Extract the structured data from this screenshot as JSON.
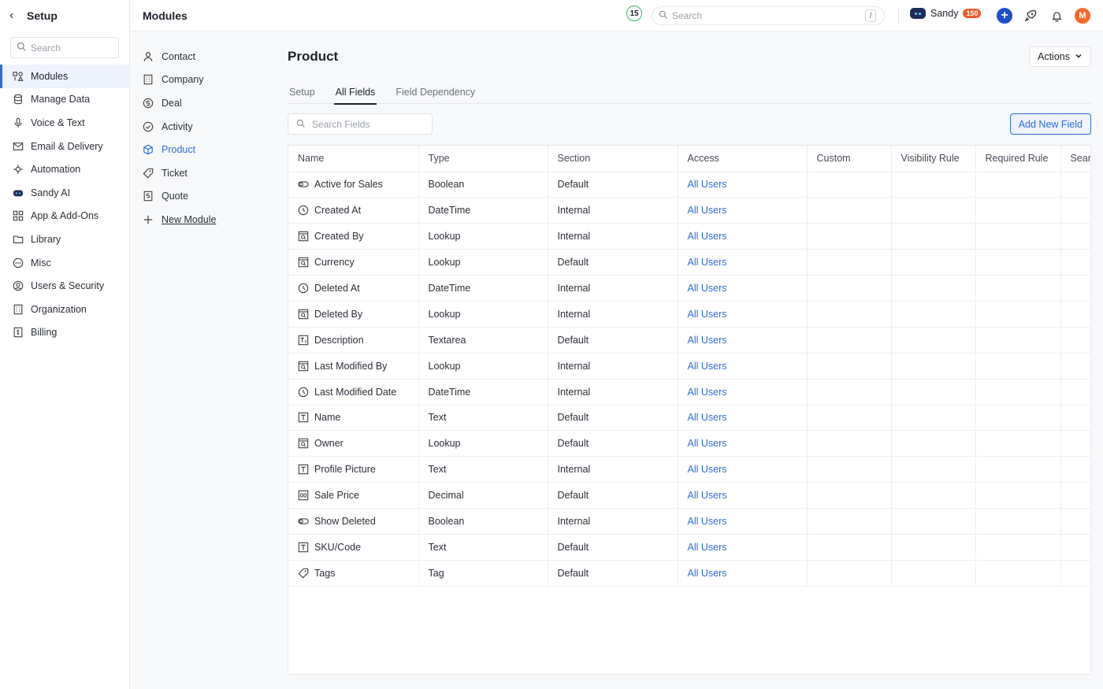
{
  "sidebar": {
    "title": "Setup",
    "search_placeholder": "Search",
    "items": [
      {
        "label": "Modules",
        "icon": "modules-icon",
        "active": true
      },
      {
        "label": "Manage Data",
        "icon": "database-icon"
      },
      {
        "label": "Voice & Text",
        "icon": "microphone-icon"
      },
      {
        "label": "Email & Delivery",
        "icon": "mail-icon"
      },
      {
        "label": "Automation",
        "icon": "automation-icon"
      },
      {
        "label": "Sandy AI",
        "icon": "bot-icon"
      },
      {
        "label": "App & Add-Ons",
        "icon": "apps-grid-icon"
      },
      {
        "label": "Library",
        "icon": "folder-icon"
      },
      {
        "label": "Misc",
        "icon": "more-circle-icon"
      },
      {
        "label": "Users & Security",
        "icon": "user-circle-icon"
      },
      {
        "label": "Organization",
        "icon": "building-icon"
      },
      {
        "label": "Billing",
        "icon": "billing-icon"
      }
    ]
  },
  "topbar": {
    "title": "Modules",
    "count": "15",
    "search_placeholder": "Search",
    "search_shortcut": "/",
    "user_name": "Sandy",
    "credits": "150",
    "avatar_letter": "M"
  },
  "modules": [
    {
      "label": "Contact",
      "icon": "person-icon"
    },
    {
      "label": "Company",
      "icon": "building-icon"
    },
    {
      "label": "Deal",
      "icon": "dollar-icon"
    },
    {
      "label": "Activity",
      "icon": "check-circle-icon"
    },
    {
      "label": "Product",
      "icon": "cube-icon",
      "active": true
    },
    {
      "label": "Ticket",
      "icon": "tag-icon"
    },
    {
      "label": "Quote",
      "icon": "quote-icon"
    },
    {
      "label": "New Module",
      "icon": "plus-icon",
      "is_new": true
    }
  ],
  "main": {
    "title": "Product",
    "actions_label": "Actions",
    "tabs": [
      {
        "label": "Setup"
      },
      {
        "label": "All Fields",
        "active": true
      },
      {
        "label": "Field Dependency"
      }
    ],
    "search_placeholder": "Search Fields",
    "add_field_label": "Add New Field",
    "columns": [
      "Name",
      "Type",
      "Section",
      "Access",
      "Custom",
      "Visibility Rule",
      "Required Rule",
      "Searc"
    ],
    "rows": [
      {
        "name": "Active for Sales",
        "type": "Boolean",
        "section": "Default",
        "access": "All Users",
        "icon": "toggle-icon"
      },
      {
        "name": "Created At",
        "type": "DateTime",
        "section": "Internal",
        "access": "All Users",
        "icon": "clock-icon"
      },
      {
        "name": "Created By",
        "type": "Lookup",
        "section": "Internal",
        "access": "All Users",
        "icon": "lookup-icon"
      },
      {
        "name": "Currency",
        "type": "Lookup",
        "section": "Default",
        "access": "All Users",
        "icon": "lookup-icon"
      },
      {
        "name": "Deleted At",
        "type": "DateTime",
        "section": "Internal",
        "access": "All Users",
        "icon": "clock-icon"
      },
      {
        "name": "Deleted By",
        "type": "Lookup",
        "section": "Internal",
        "access": "All Users",
        "icon": "lookup-icon"
      },
      {
        "name": "Description",
        "type": "Textarea",
        "section": "Default",
        "access": "All Users",
        "icon": "textarea-icon"
      },
      {
        "name": "Last Modified By",
        "type": "Lookup",
        "section": "Internal",
        "access": "All Users",
        "icon": "lookup-icon"
      },
      {
        "name": "Last Modified Date",
        "type": "DateTime",
        "section": "Internal",
        "access": "All Users",
        "icon": "clock-icon"
      },
      {
        "name": "Name",
        "type": "Text",
        "section": "Default",
        "access": "All Users",
        "icon": "text-icon"
      },
      {
        "name": "Owner",
        "type": "Lookup",
        "section": "Default",
        "access": "All Users",
        "icon": "lookup-icon"
      },
      {
        "name": "Profile Picture",
        "type": "Text",
        "section": "Internal",
        "access": "All Users",
        "icon": "text-icon"
      },
      {
        "name": "Sale Price",
        "type": "Decimal",
        "section": "Default",
        "access": "All Users",
        "icon": "decimal-icon"
      },
      {
        "name": "Show Deleted",
        "type": "Boolean",
        "section": "Internal",
        "access": "All Users",
        "icon": "toggle-icon"
      },
      {
        "name": "SKU/Code",
        "type": "Text",
        "section": "Default",
        "access": "All Users",
        "icon": "text-icon"
      },
      {
        "name": "Tags",
        "type": "Tag",
        "section": "Default",
        "access": "All Users",
        "icon": "tag-icon"
      }
    ]
  },
  "colors": {
    "accent": "#2f6bde",
    "brand_plus": "#1d4fc9",
    "avatar": "#f26b2a",
    "badge_green": "#3db36b"
  }
}
